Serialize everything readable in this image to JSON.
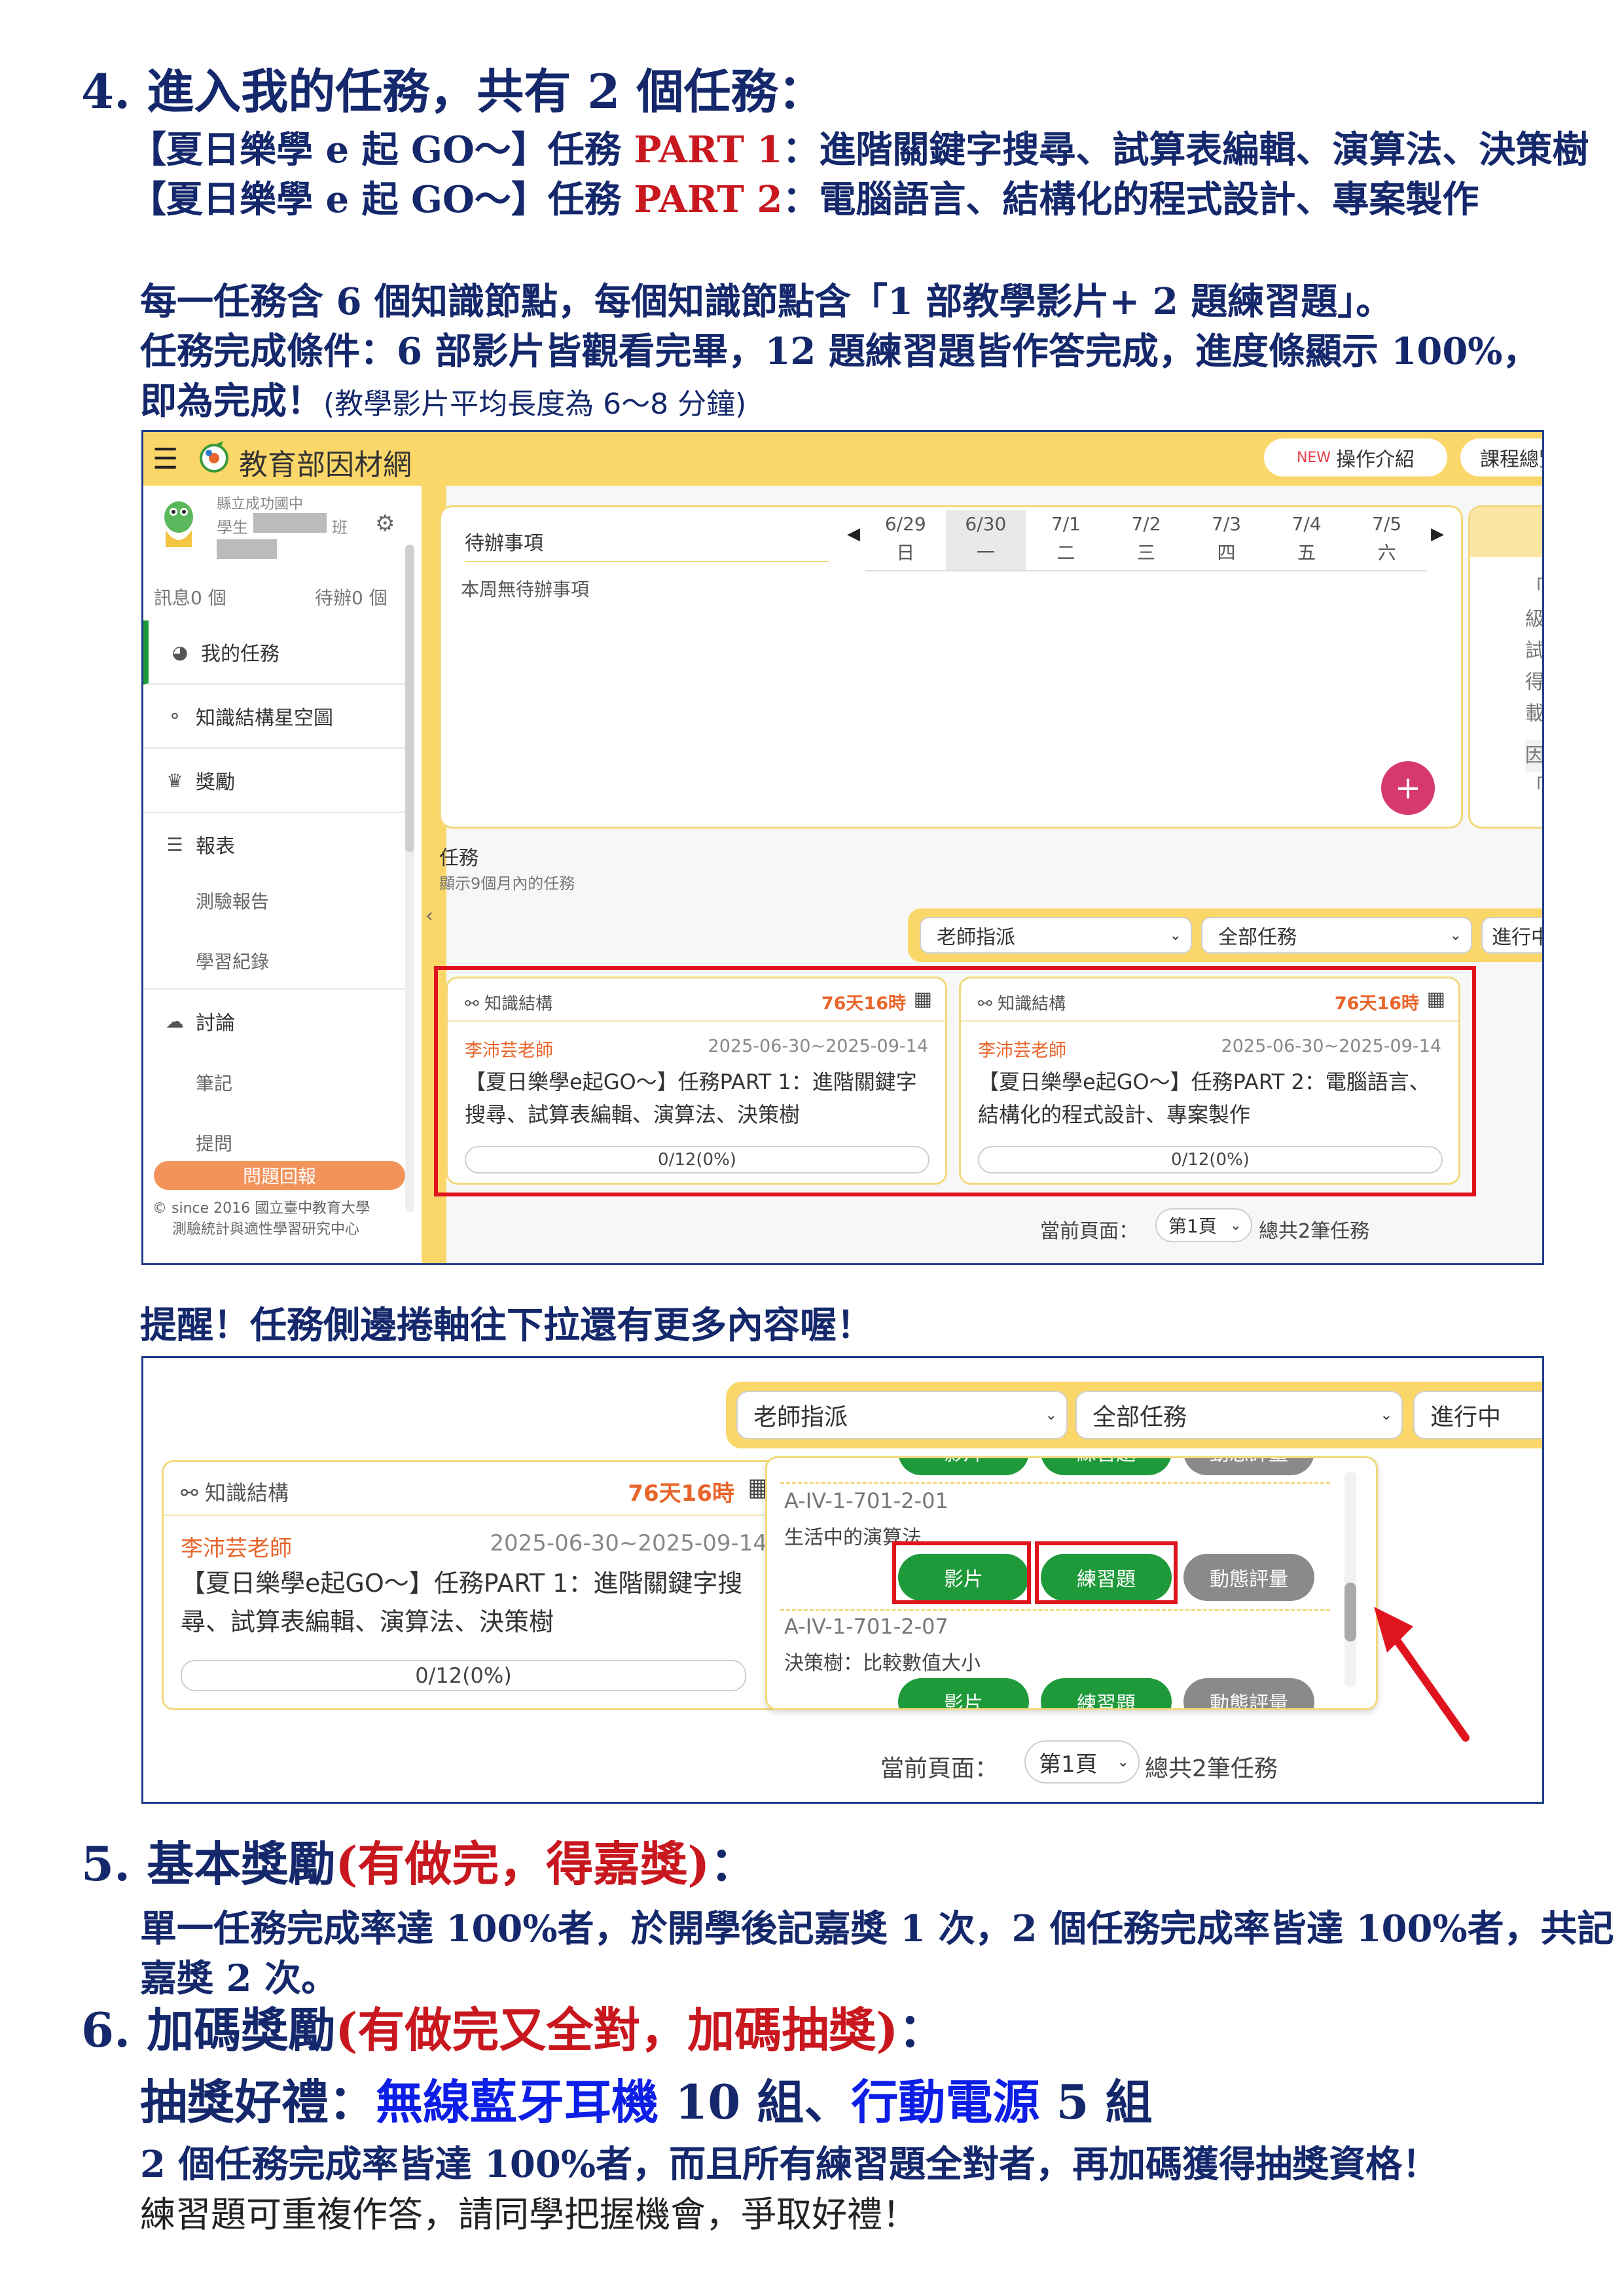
{
  "sec4": {
    "title": "4. 進入我的任務，共有 2 個任務：",
    "part1_prefix": "【夏日樂學 e 起 GO～】任務 ",
    "part1_tag": "PART 1",
    "part1_rest": "：進階關鍵字搜尋、試算表編輯、演算法、決策樹",
    "part2_prefix": "【夏日樂學 e 起 GO～】任務 ",
    "part2_tag": "PART 2",
    "part2_rest": "：電腦語言、結構化的程式設計、專案製作",
    "desc1": "每一任務含 6 個知識節點，每個知識節點含「1 部教學影片+ 2 題練習題」。",
    "desc2": "任務完成條件：6 部影片皆觀看完畢，12 題練習題皆作答完成，進度條顯示 100%，",
    "desc3_bold": "即為完成！",
    "desc3_normal": "(教學影片平均長度為 6～8 分鐘)"
  },
  "shot1": {
    "site_name": "教育部因材網",
    "btn_intro_new": "NEW",
    "btn_intro": "操作介紹",
    "btn_course": "課程總覽",
    "school": "縣立成功國中",
    "student_label": "學生",
    "class_label": "班",
    "msg_count": "訊息0 個",
    "todo_count": "待辦0 個",
    "menu": [
      {
        "icon": "dashboard-icon",
        "glyph": "◕",
        "label": "我的任務"
      },
      {
        "icon": "share-icon",
        "glyph": "⚬",
        "label": "知識結構星空圖"
      },
      {
        "icon": "reward-icon",
        "glyph": "♛",
        "label": "獎勵"
      },
      {
        "icon": "chart-icon",
        "glyph": "☰",
        "label": "報表"
      }
    ],
    "submenu_report": [
      "測驗報告",
      "學習紀錄"
    ],
    "discuss": {
      "glyph": "☁",
      "label": "討論"
    },
    "submenu_discuss": [
      "筆記",
      "提問"
    ],
    "report_btn": "問題回報",
    "footer1": "© since 2016 國立臺中教育大學",
    "footer2": "測驗統計與適性學習研究中心",
    "todo_title": "待辦事項",
    "todo_empty": "本周無待辦事項",
    "days": [
      {
        "date": "6/29",
        "wd": "日"
      },
      {
        "date": "6/30",
        "wd": "一"
      },
      {
        "date": "7/1",
        "wd": "二"
      },
      {
        "date": "7/2",
        "wd": "三"
      },
      {
        "date": "7/3",
        "wd": "四"
      },
      {
        "date": "7/4",
        "wd": "五"
      },
      {
        "date": "7/5",
        "wd": "六"
      }
    ],
    "side_chars": [
      "「",
      "級",
      "試",
      "得",
      "載",
      "因",
      "「"
    ],
    "task_title": "任務",
    "task_sub": "顯示9個月內的任務",
    "filter1": "老師指派",
    "filter2": "全部任務",
    "filter3": "進行中",
    "cards": [
      {
        "tag": "知識結構",
        "dur": "76天16時",
        "teacher": "李沛芸老師",
        "dates": "2025-06-30~2025-09-14",
        "title": "【夏日樂學e起GO～】任務PART 1：進階關鍵字搜尋、試算表編輯、演算法、決策樹",
        "progress": "0/12(0%)"
      },
      {
        "tag": "知識結構",
        "dur": "76天16時",
        "teacher": "李沛芸老師",
        "dates": "2025-06-30~2025-09-14",
        "title": "【夏日樂學e起GO～】任務PART 2：電腦語言、結構化的程式設計、專案製作",
        "progress": "0/12(0%)"
      }
    ],
    "page_label": "當前頁面：",
    "page_sel": "第1頁",
    "page_total": "總共2筆任務"
  },
  "reminder": "提醒！任務側邊捲軸往下拉還有更多內容喔！",
  "shot2": {
    "filter1": "老師指派",
    "filter2": "全部任務",
    "filter3": "進行中",
    "card": {
      "tag": "知識結構",
      "dur": "76天16時",
      "teacher": "李沛芸老師",
      "dates": "2025-06-30~2025-09-14",
      "title": "【夏日樂學e起GO～】任務PART 1：進階關鍵字搜尋、試算表編輯、演算法、決策樹",
      "progress": "0/12(0%)"
    },
    "top_btns": [
      "影片",
      "練習題",
      "動態評量"
    ],
    "node1_code": "A-IV-1-701-2-01",
    "node1_name": "生活中的演算法",
    "node1_btns": [
      "影片",
      "練習題",
      "動態評量"
    ],
    "node2_code": "A-IV-1-701-2-07",
    "node2_name": "決策樹：比較數值大小",
    "node2_btns": [
      "影片",
      "練習題",
      "動態評量"
    ],
    "page_label": "當前頁面：",
    "page_sel": "第1頁",
    "page_total": "總共2筆任務"
  },
  "sec5": {
    "title_a": "5. 基本獎勵",
    "title_b": "(有做完，得嘉獎)",
    "title_c": "：",
    "line1": "單一任務完成率達 100%者，於開學後記嘉獎 1 次，2 個任務完成率皆達 100%者，共記",
    "line2": "嘉獎 2 次。"
  },
  "sec6": {
    "title_a": "6. 加碼獎勵",
    "title_b": "(有做完又全對，加碼抽獎)",
    "title_c": "：",
    "prize_a": "抽獎好禮：",
    "prize_b": "無線藍牙耳機",
    "prize_c": " 10 組、",
    "prize_d": "行動電源",
    "prize_e": " 5 組",
    "line1": "2 個任務完成率皆達 100%者，而且所有練習題全對者，再加碼獲得抽獎資格！",
    "line2": "練習題可重複作答，請同學把握機會，爭取好禮！"
  },
  "colors": {
    "navy": "#14286b",
    "red": "#c8171e",
    "blue": "#0d1ee6",
    "yellow": "#fbd76a",
    "green": "#1f9a3a",
    "orange": "#e8652b"
  }
}
